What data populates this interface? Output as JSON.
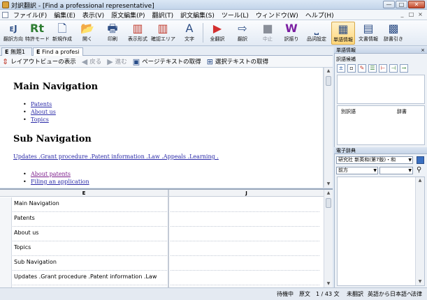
{
  "window": {
    "title": "対訳翻訳 - [Find a professional representative]",
    "minimize": "—",
    "maximize": "□",
    "close": "✕"
  },
  "menu": [
    "ファイル(F)",
    "編集(E)",
    "表示(V)",
    "原文編集(P)",
    "翻訳(T)",
    "訳文編集(S)",
    "ツール(L)",
    "ウィンドウ(W)",
    "ヘルプ(H)"
  ],
  "mdi_buttons": [
    "_",
    "□",
    "×"
  ],
  "toolbar": [
    {
      "icon": "translate-direction-icon",
      "glyph": "ᴇJ",
      "label": "翻訳方向"
    },
    {
      "icon": "special-mode-icon",
      "glyph": "Rt",
      "label": "特許モード"
    },
    {
      "icon": "new-file-icon",
      "glyph": "🗋",
      "label": "新規作成"
    },
    {
      "icon": "open-folder-icon",
      "glyph": "📂",
      "label": "開く"
    },
    {
      "icon": "printer-icon",
      "glyph": "🖶",
      "label": "印刷"
    },
    {
      "icon": "display-format-icon",
      "glyph": "▥",
      "label": "表示形式"
    },
    {
      "icon": "confirm-area-icon",
      "glyph": "▥",
      "label": "確認エリア"
    },
    {
      "icon": "text-icon",
      "glyph": "A",
      "label": "文字"
    },
    {
      "icon": "translate-all-icon",
      "glyph": "▶",
      "label": "全翻訳"
    },
    {
      "icon": "translate-icon",
      "glyph": "⇨",
      "label": "翻訳"
    },
    {
      "icon": "stop-icon",
      "glyph": "■",
      "label": "中止"
    },
    {
      "icon": "alternative-icon",
      "glyph": "W",
      "label": "訳振り"
    },
    {
      "icon": "quality-setting-icon",
      "glyph": "⎵",
      "label": "品詞設定"
    },
    {
      "icon": "word-info-icon",
      "glyph": "▦",
      "label": "単語情報"
    },
    {
      "icon": "sentence-info-icon",
      "glyph": "▤",
      "label": "文書情報"
    },
    {
      "icon": "dictionary-lookup-icon",
      "glyph": "▩",
      "label": "辞書引き"
    }
  ],
  "doc_tabs": [
    {
      "prefix": "E",
      "label": "無題1"
    },
    {
      "prefix": "E",
      "label": "Find a profesi"
    }
  ],
  "view_toolbar": [
    {
      "icon": "layout-view-icon",
      "glyph": "⇕",
      "label": "レイアウトビューの表示"
    },
    {
      "icon": "back-icon",
      "glyph": "◀",
      "label": "戻る"
    },
    {
      "icon": "forward-icon",
      "glyph": "▶",
      "label": "進む"
    },
    {
      "icon": "get-page-text-icon",
      "glyph": "▣",
      "label": "ページテキストの取得"
    },
    {
      "icon": "get-selection-icon",
      "glyph": "⊞",
      "label": "選択テキストの取得"
    }
  ],
  "browser": {
    "heading1": "Main Navigation",
    "main_links": [
      "Patents",
      "About us",
      "Topics"
    ],
    "heading2": "Sub Navigation",
    "sub_links_line": "Updates .Grant procedure .Patent information .Law .Appeals .Learning .",
    "sub_links": [
      "About patents",
      "Filing an application"
    ]
  },
  "grid": {
    "col_source": "E",
    "col_target": "J",
    "rows": [
      "Main Navigation",
      "Patents",
      "About us",
      "Topics",
      "Sub Navigation",
      "Updates .Grant procedure .Patent information .Law"
    ]
  },
  "side_panel": {
    "header": "単語情報",
    "sub_label": "訳語候補",
    "list_col1": "別訳語",
    "list_col2": "辞書",
    "dict_header": "電子辞典",
    "dict_combo": "研究社 新英和(第7版)・和",
    "search_combo": "前方"
  },
  "status": {
    "state": "待機中",
    "kind": "原文",
    "count": "1 / 43 文",
    "trans_state": "未翻訳",
    "direction": "英語から日本語へ",
    "mode": "法律"
  }
}
